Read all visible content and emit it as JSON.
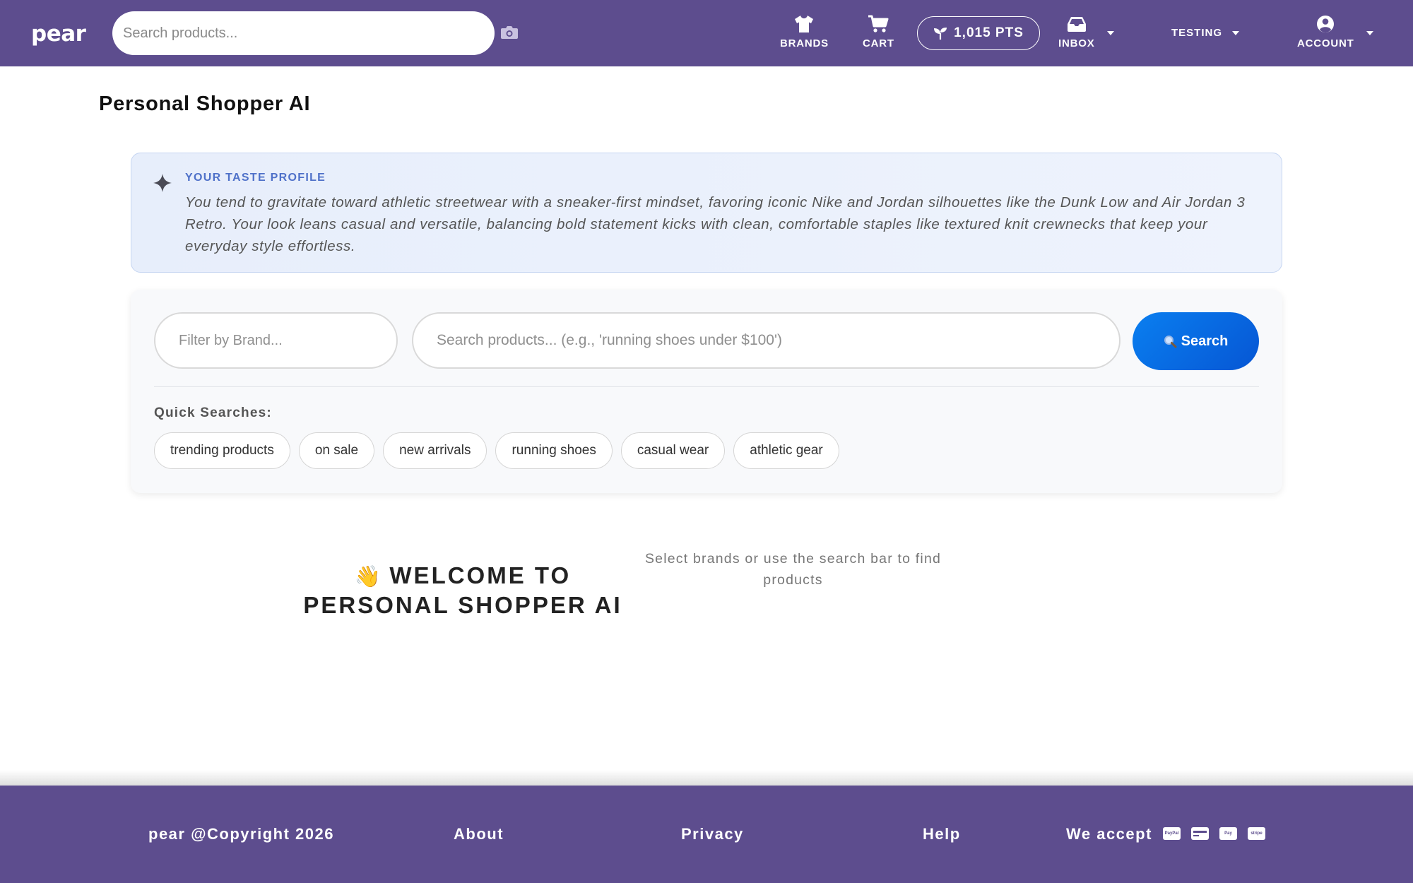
{
  "colors": {
    "nav_bg": "#5d4d8e",
    "accent_blue": "#0a6ff0",
    "taste_label": "#4f71c9"
  },
  "navbar": {
    "logo": "pear",
    "search_placeholder": "Search products...",
    "brands_label": "BRANDS",
    "cart_label": "CART",
    "points_label": "1,015 PTS",
    "inbox_label": "INBOX",
    "testing_label": "TESTING",
    "account_label": "ACCOUNT",
    "icons": [
      "camera-icon",
      "shirt-icon",
      "cart-icon",
      "sprout-icon",
      "inbox-icon",
      "account-circle-icon"
    ]
  },
  "page": {
    "title": "Personal Shopper AI"
  },
  "taste_profile": {
    "label": "YOUR TASTE PROFILE",
    "text": "You tend to gravitate toward athletic streetwear with a sneaker-first mindset, favoring iconic Nike and Jordan silhouettes like the Dunk Low and Air Jordan 3 Retro. Your look leans casual and versatile, balancing bold statement kicks with clean, comfortable staples like textured knit crewnecks that keep your everyday style effortless."
  },
  "search_panel": {
    "brand_placeholder": "Filter by Brand...",
    "search_placeholder": "Search products... (e.g., 'running shoes under $100')",
    "search_button": "Search",
    "quick_label": "Quick Searches:",
    "quick_searches": [
      "trending products",
      "on sale",
      "new arrivals",
      "running shoes",
      "casual wear",
      "athletic gear"
    ]
  },
  "welcome": {
    "emoji": "👋",
    "title": "WELCOME TO PERSONAL SHOPPER AI",
    "subtitle": "Select brands or use the search bar to find products"
  },
  "footer": {
    "copyright": "pear @Copyright 2026",
    "about": "About",
    "privacy": "Privacy",
    "help": "Help",
    "we_accept": "We accept",
    "payments": [
      "PayPal",
      "Card",
      "Pay",
      "stripe"
    ]
  }
}
